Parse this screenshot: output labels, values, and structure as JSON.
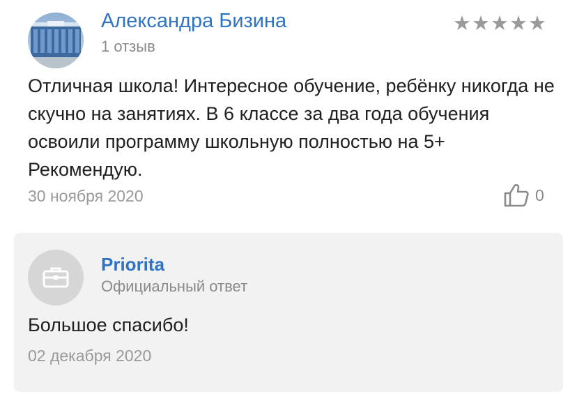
{
  "review": {
    "author_name": "Александра Бизина",
    "review_count": "1 отзыв",
    "rating": 5,
    "stars": "★★★★★",
    "text": "Отличная школа! Интересное обучение, ребёнку никогда не скучно на занятиях. В 6 классе за два года обучения освоили программу школьную полностью на 5+ Рекомендую.",
    "date": "30 ноября 2020",
    "likes": "0",
    "like_icon": "thumbs-up-icon",
    "avatar": "avatar-photo"
  },
  "reply": {
    "org_name": "Priorita",
    "subtitle": "Официальный ответ",
    "text": "Большое спасибо!",
    "date": "02 декабря 2020",
    "org_icon": "briefcase-icon"
  },
  "colors": {
    "link_blue": "#2f73c4",
    "muted_gray": "#8a8a8a",
    "reply_bg": "#f2f2f2"
  }
}
